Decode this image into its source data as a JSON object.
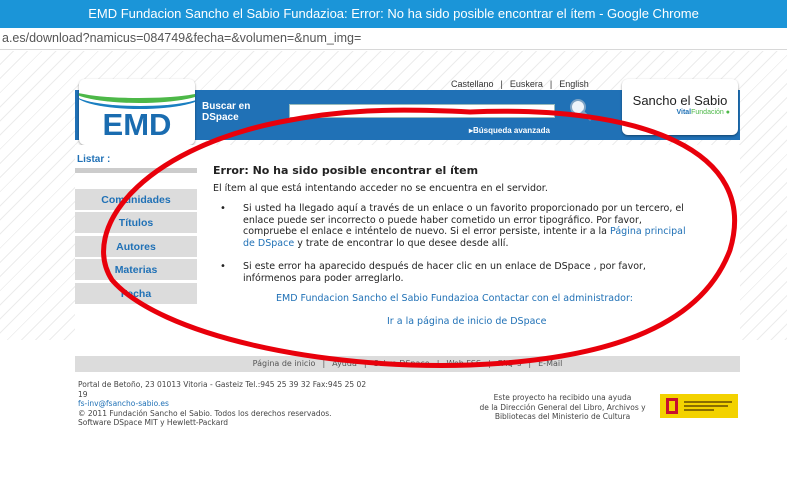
{
  "window": {
    "title": "EMD Fundacion Sancho el Sabio Fundazioa: Error: No ha sido posible encontrar el ítem - Google Chrome",
    "url": "a.es/download?namicus=084749&fecha=&volumen=&num_img="
  },
  "header": {
    "logo_text": "EMD",
    "search_label": "Buscar en DSpace",
    "advanced_search": "▸Búsqueda avanzada",
    "languages": [
      "Castellano",
      "Euskera",
      "English"
    ],
    "sancho_title": "Sancho el Sabio",
    "sancho_sub_brand": "Vital",
    "sancho_sub_rest": "Fundación"
  },
  "sidebar": {
    "heading": "Listar :",
    "items": [
      "Comunidades",
      "Títulos",
      "Autores",
      "Materias",
      "Fecha"
    ]
  },
  "main": {
    "title": "Error: No ha sido posible encontrar el ítem",
    "description": "El ítem al que está intentando acceder no se encuentra en el servidor.",
    "bullet1_lines": [
      "Si usted ha llegado aquí a través de un enlace o un favorito proporcionado por un tercero, el",
      "enlace puede ser incorrecto o puede haber cometido un error tipográfico. Por favor,",
      "compruebe el enlace e inténtelo de nuevo. Si el error persiste, intente ir a la"
    ],
    "bullet1_link_a": "Página principal",
    "bullet1_link_b": "de DSpace",
    "bullet1_tail": " y trate de encontrar lo que desee desde allí.",
    "bullet2_lines": [
      "Si este error ha aparecido después de hacer clic en un enlace de DSpace , por favor,",
      "infórmenos para poder arreglarlo."
    ],
    "contact_link": "EMD Fundacion Sancho el Sabio Fundazioa Contactar con el administrador:",
    "home_link": "Ir a la página de inicio de DSpace"
  },
  "footer": {
    "nav": [
      "Página de inicio",
      "Ayuda",
      "Sobre DSpace",
      "Web FSS",
      "FAQ´s",
      "E-Mail"
    ],
    "address_lines": [
      "Portal de Betoño, 23 01013 Vitoria - Gasteiz Tel.:945 25 39 32 Fax:945 25 02",
      "19"
    ],
    "email": "fs-inv@fsancho-sabio.es",
    "copyright": "© 2011 Fundación Sancho el Sabio. Todos los derechos reservados.",
    "software": "Software DSpace MIT y Hewlett-Packard",
    "funding_lines": [
      "Este proyecto ha recibido una ayuda",
      "de la Dirección General del Libro, Archivos y",
      "Bibliotecas del Ministerio de Cultura"
    ]
  },
  "colors": {
    "header_blue": "#2071b6",
    "link_blue": "#2071b6",
    "annotation_red": "#e8000b",
    "ministry_yellow": "#f3d200"
  }
}
